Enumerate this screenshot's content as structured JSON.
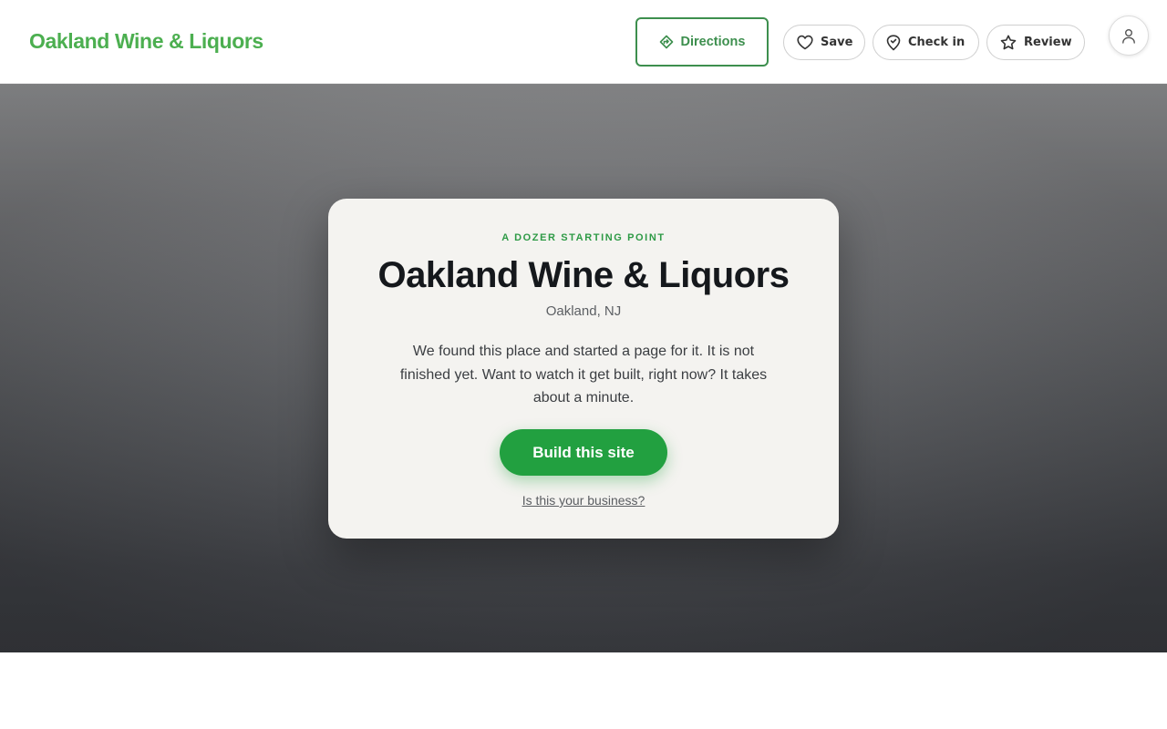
{
  "header": {
    "brand": "Oakland Wine & Liquors",
    "actions": {
      "directions": "Directions",
      "save": "Save",
      "check_in": "Check in",
      "review": "Review"
    },
    "icons": {
      "directions": "directions-icon",
      "save": "heart-icon",
      "check_in": "map-pin-icon",
      "review": "star-icon",
      "account": "user-icon"
    }
  },
  "card": {
    "eyebrow": "A DOZER STARTING POINT",
    "title": "Oakland Wine & Liquors",
    "location": "Oakland, NJ",
    "description": "We found this place and started a page for it. It is not finished yet. Want to watch it get built, right now? It takes about a minute.",
    "cta": "Build this site",
    "claim_link": "Is this your business?"
  },
  "colors": {
    "brand_green": "#4caf50",
    "cta_green": "#22a040",
    "outline_green": "#3d8f4e"
  }
}
